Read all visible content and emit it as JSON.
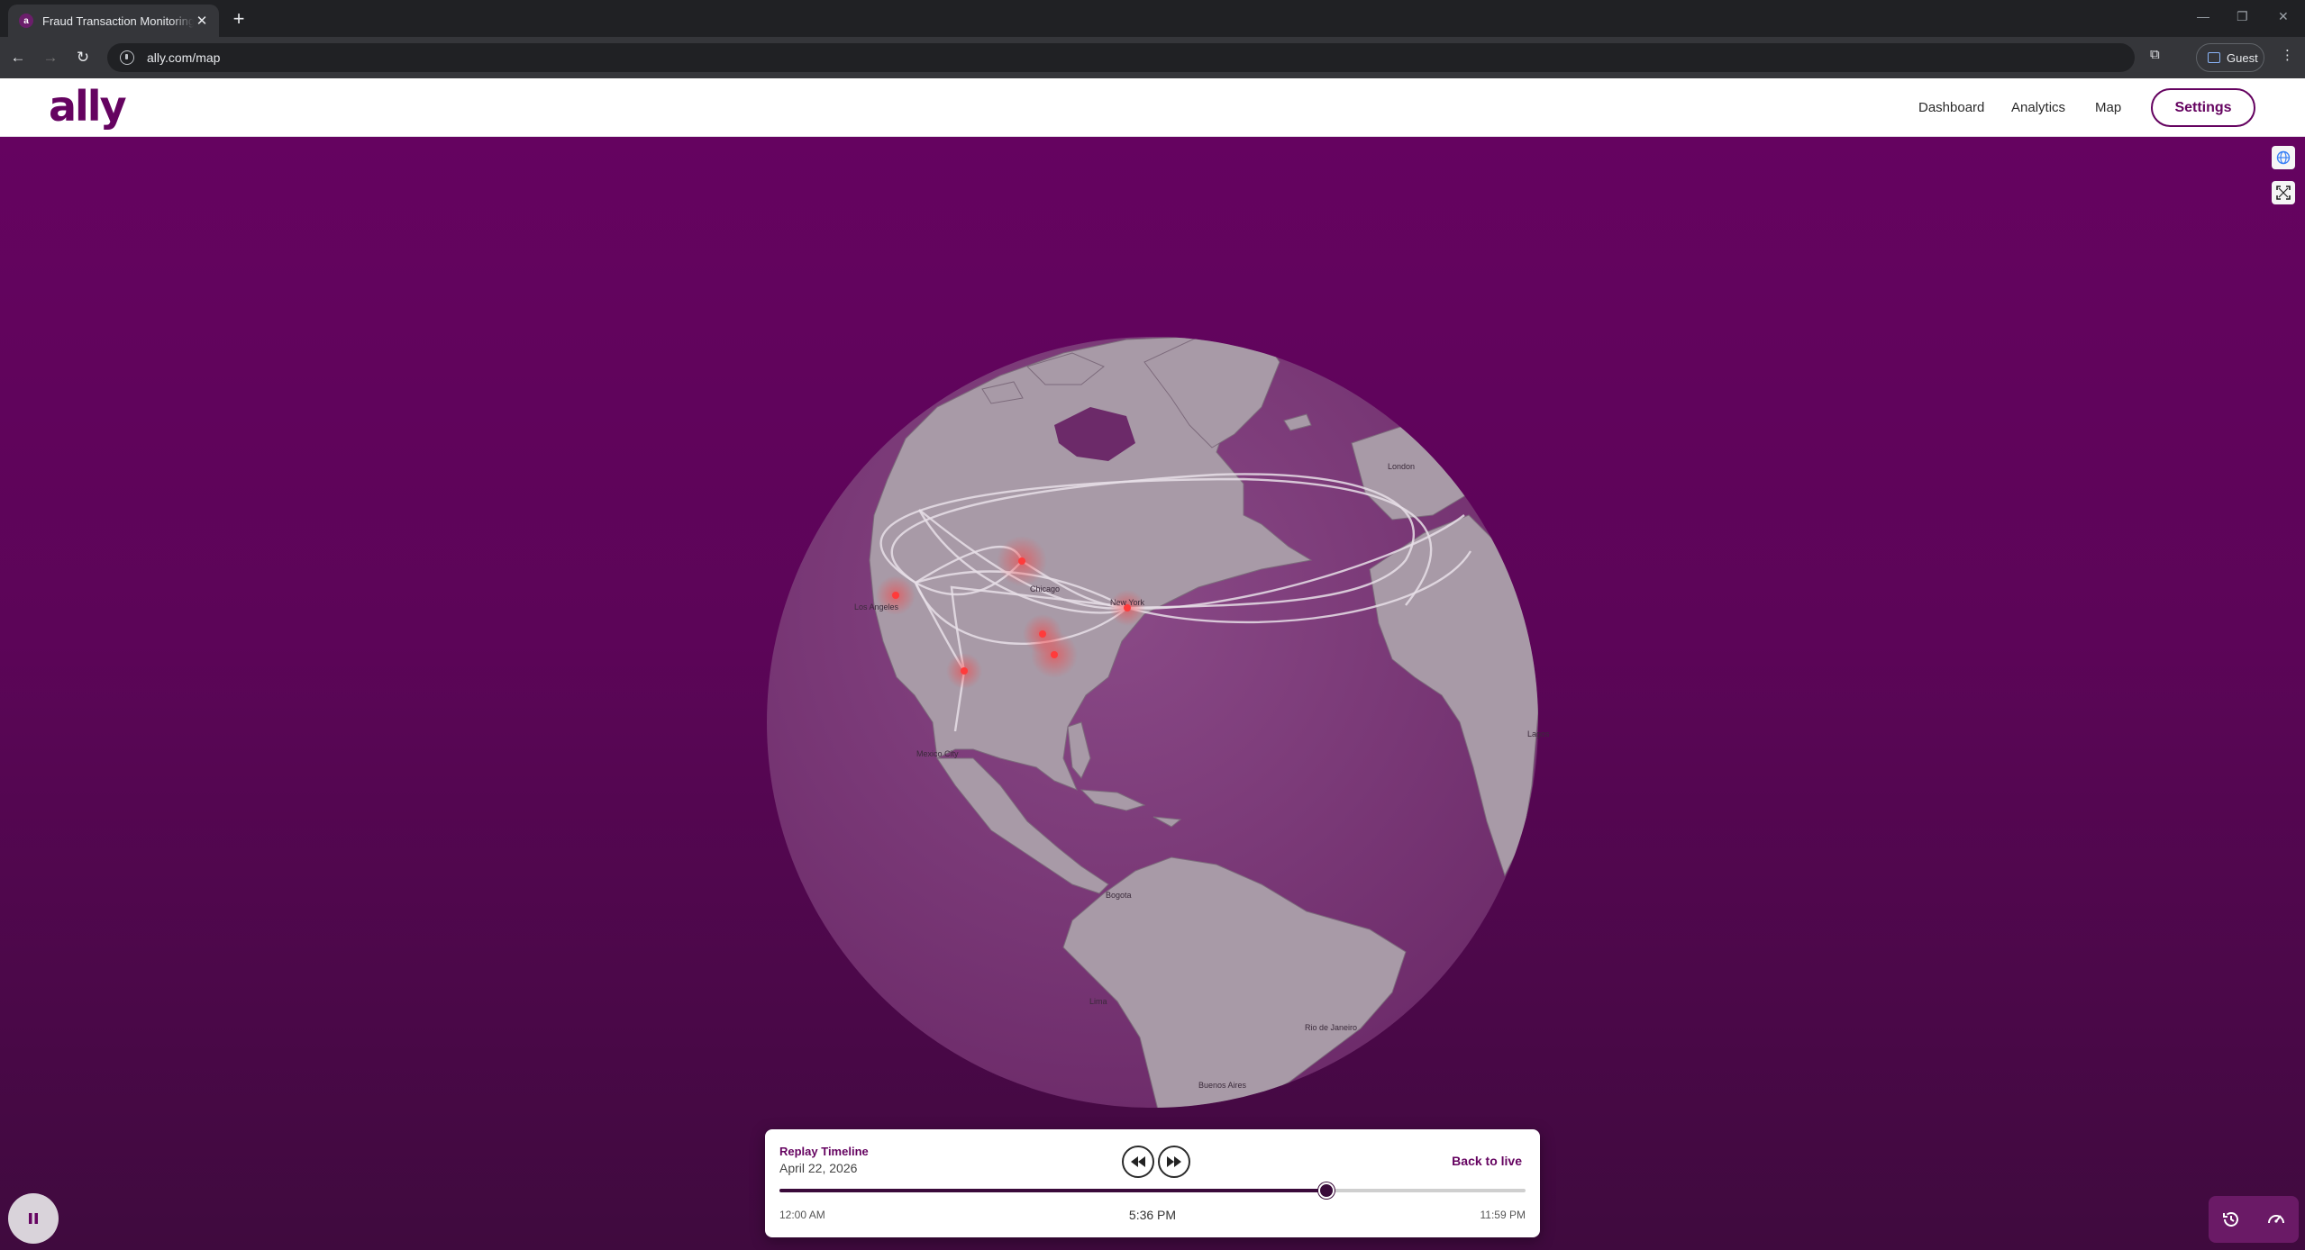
{
  "browser": {
    "tab_title": "Fraud Transaction Monitoring D",
    "favicon": "a",
    "url": "ally.com/map",
    "profile": "Guest"
  },
  "header": {
    "logo": "ally",
    "nav": [
      "Dashboard",
      "Analytics",
      "Map"
    ],
    "settings_label": "Settings"
  },
  "map": {
    "cities": [
      {
        "name": "Los Angeles"
      },
      {
        "name": "Chicago"
      },
      {
        "name": "New York"
      },
      {
        "name": "Mexico City"
      },
      {
        "name": "Bogota"
      },
      {
        "name": "Lima"
      },
      {
        "name": "Rio de Janeiro"
      },
      {
        "name": "Buenos Aires"
      },
      {
        "name": "London"
      },
      {
        "name": "Lagos"
      }
    ]
  },
  "timeline": {
    "title": "Replay Timeline",
    "date": "April 22, 2026",
    "back_to_live": "Back to live",
    "start_label": "12:00 AM",
    "current_label": "5:36 PM",
    "end_label": "11:59 PM",
    "progress": 0.733
  },
  "colors": {
    "brand": "#650360",
    "hotspot": "#ff3b3b"
  }
}
